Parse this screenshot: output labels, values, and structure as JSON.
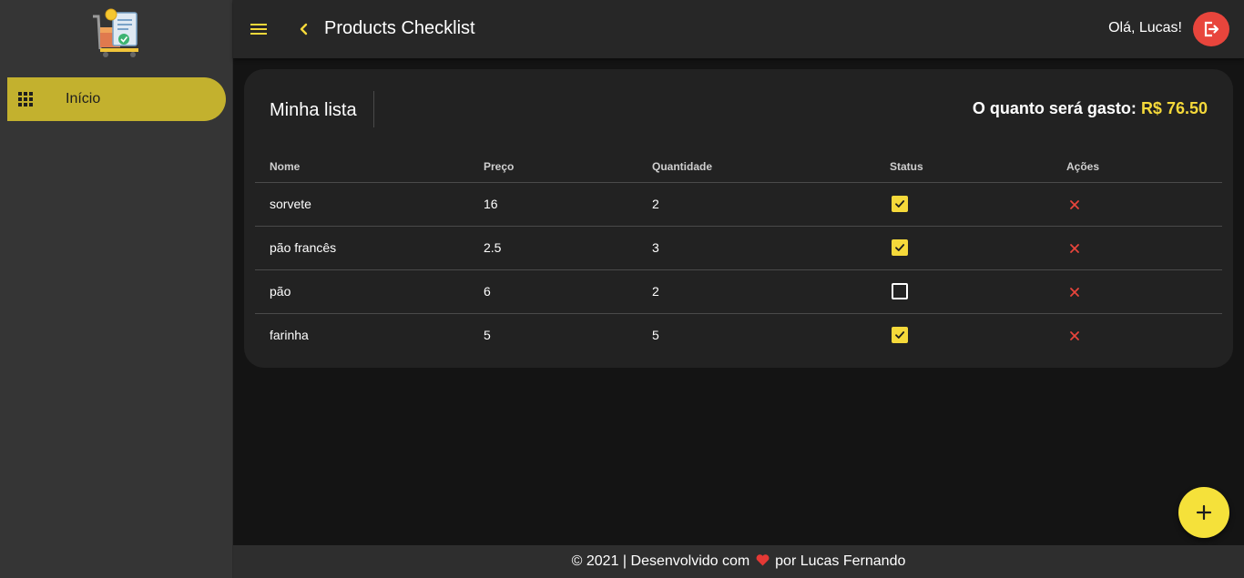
{
  "app": {
    "title": "Products Checklist",
    "greeting": "Olá, Lucas!"
  },
  "sidebar": {
    "items": [
      {
        "label": "Início",
        "icon": "apps-grid-icon",
        "active": true
      }
    ]
  },
  "card": {
    "title": "Minha lista",
    "total_label": "O quanto será gasto:",
    "total_value": "R$ 76.50"
  },
  "table": {
    "headers": [
      "Nome",
      "Preço",
      "Quantidade",
      "Status",
      "Ações"
    ],
    "rows": [
      {
        "nome": "sorvete",
        "preco": "16",
        "quantidade": "2",
        "status": true
      },
      {
        "nome": "pão francês",
        "preco": "2.5",
        "quantidade": "3",
        "status": true
      },
      {
        "nome": "pão",
        "preco": "6",
        "quantidade": "2",
        "status": false
      },
      {
        "nome": "farinha",
        "preco": "5",
        "quantidade": "5",
        "status": true
      }
    ]
  },
  "footer": {
    "prefix": "© 2021 | Desenvolvido com",
    "suffix": "por Lucas Fernando",
    "heart_icon": "heart-icon"
  },
  "colors": {
    "accent": "#f5d93a",
    "sidebar_active": "#c3b12e",
    "danger": "#e8453c"
  }
}
